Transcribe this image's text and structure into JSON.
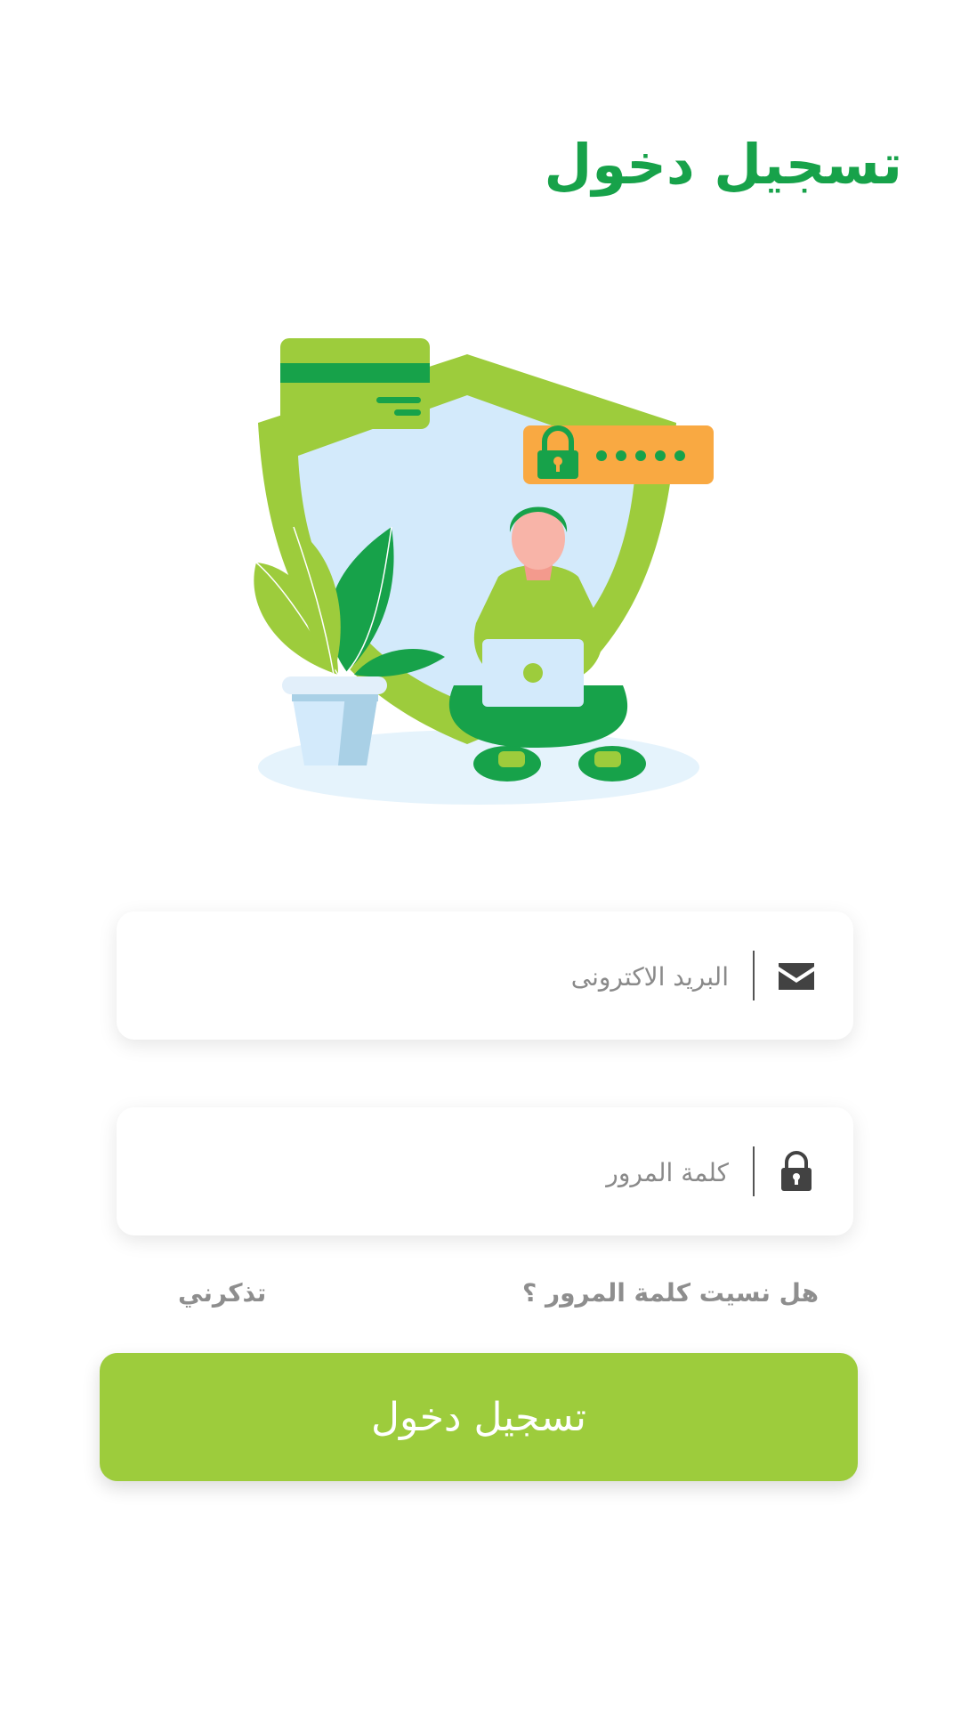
{
  "header": {
    "title": "تسجيل دخول"
  },
  "form": {
    "email": {
      "placeholder": "البريد الاكترونى",
      "icon": "envelope-icon"
    },
    "password": {
      "placeholder": "كلمة المرور",
      "icon": "lock-icon"
    },
    "forgot_password": "هل نسيت كلمة المرور ؟",
    "remember_me": "تذكرني",
    "submit_label": "تسجيل دخول"
  },
  "illustration": {
    "password_dots": "•••••",
    "icons": [
      "shield-icon",
      "credit-card-icon",
      "lock-icon",
      "laptop-icon",
      "plant-icon"
    ]
  },
  "colors": {
    "primary": "#17a24a",
    "accent": "#9dcc3c",
    "muted_text": "#8e8e8e",
    "shield_fill": "#d3eafb",
    "password_badge": "#f9a942"
  }
}
